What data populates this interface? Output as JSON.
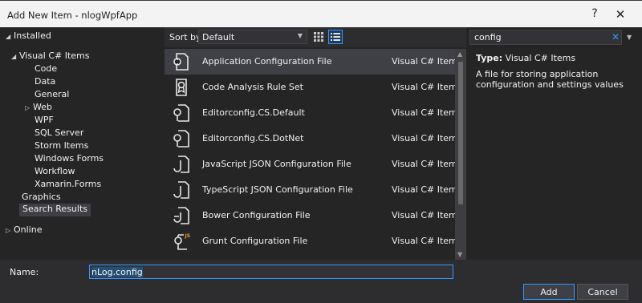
{
  "window": {
    "title": "Add New Item - nlogWpfApp",
    "help_label": "?",
    "close_label": "✕"
  },
  "tree": {
    "installed": "Installed",
    "visual_csharp": "Visual C# Items",
    "children": [
      "Code",
      "Data",
      "General",
      "Web",
      "WPF",
      "SQL Server",
      "Storm Items",
      "Windows Forms",
      "Workflow",
      "Xamarin.Forms"
    ],
    "graphics": "Graphics",
    "search_results": "Search Results",
    "online": "Online"
  },
  "toolbar": {
    "sort_label": "Sort by:",
    "sort_value": "Default"
  },
  "items": [
    {
      "name": "Application Configuration File",
      "category": "Visual C# Items",
      "icon": "config-file-icon"
    },
    {
      "name": "Code Analysis Rule Set",
      "category": "Visual C# Items",
      "icon": "ruleset-icon"
    },
    {
      "name": "Editorconfig.CS.Default",
      "category": "Visual C# Items",
      "icon": "editorconfig-icon"
    },
    {
      "name": "Editorconfig.CS.DotNet",
      "category": "Visual C# Items",
      "icon": "editorconfig-icon"
    },
    {
      "name": "JavaScript JSON Configuration File",
      "category": "Visual C# Items",
      "icon": "json-config-icon"
    },
    {
      "name": "TypeScript JSON Configuration File",
      "category": "Visual C# Items",
      "icon": "json-config-icon"
    },
    {
      "name": "Bower Configuration File",
      "category": "Visual C# Items",
      "icon": "bower-config-icon"
    },
    {
      "name": "Grunt Configuration File",
      "category": "Visual C# Items",
      "icon": "grunt-config-icon"
    }
  ],
  "search": {
    "value": "config"
  },
  "details": {
    "type_label": "Type:",
    "type_value": "Visual C# Items",
    "description": "A file for storing application configuration and settings values"
  },
  "bottom": {
    "name_label": "Name:",
    "name_value": "nLog.config",
    "add_label": "Add",
    "cancel_label": "Cancel"
  },
  "colors": {
    "accent": "#3399ff",
    "background": "#2d2d30",
    "panel": "#252526",
    "selected": "#3f3f46"
  }
}
